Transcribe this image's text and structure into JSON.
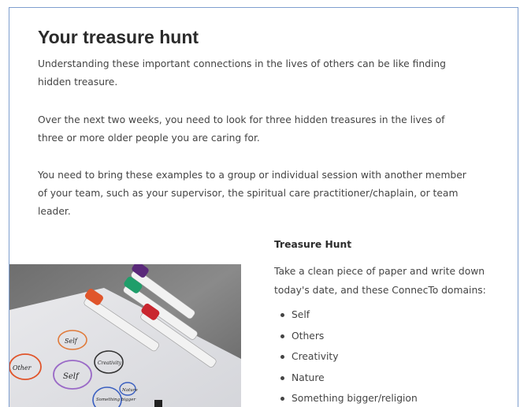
{
  "page": {
    "title": "Your treasure hunt",
    "paragraphs": [
      "Understanding these important connections in the lives of others can be like finding hidden treasure.",
      "Over the next two weeks, you need to look for three hidden treasures in the lives of three or more older people you are caring for.",
      "You need to bring these examples to a group or individual session with another member of your team, such as your supervisor, the spiritual care practitioner/chaplain, or team leader."
    ]
  },
  "photo": {
    "circle_words": [
      "Self",
      "Other",
      "Self",
      "Creativity",
      "Something bigger",
      "Nature"
    ],
    "colors": {
      "orange": "#e0552b",
      "purple": "#5a2a7a",
      "green": "#1f9e6a",
      "red": "#c9262f",
      "black": "#222222"
    }
  },
  "treasure_hunt": {
    "heading": "Treasure Hunt",
    "instruction": "Take a clean piece of paper and write down today's date, and these ConnecTo domains:",
    "domains": [
      "Self",
      "Others",
      "Creativity",
      "Nature",
      "Something bigger/religion"
    ]
  },
  "colors": {
    "frame_border": "#7f9fcf",
    "text": "#444444",
    "heading": "#2b2b2b"
  }
}
